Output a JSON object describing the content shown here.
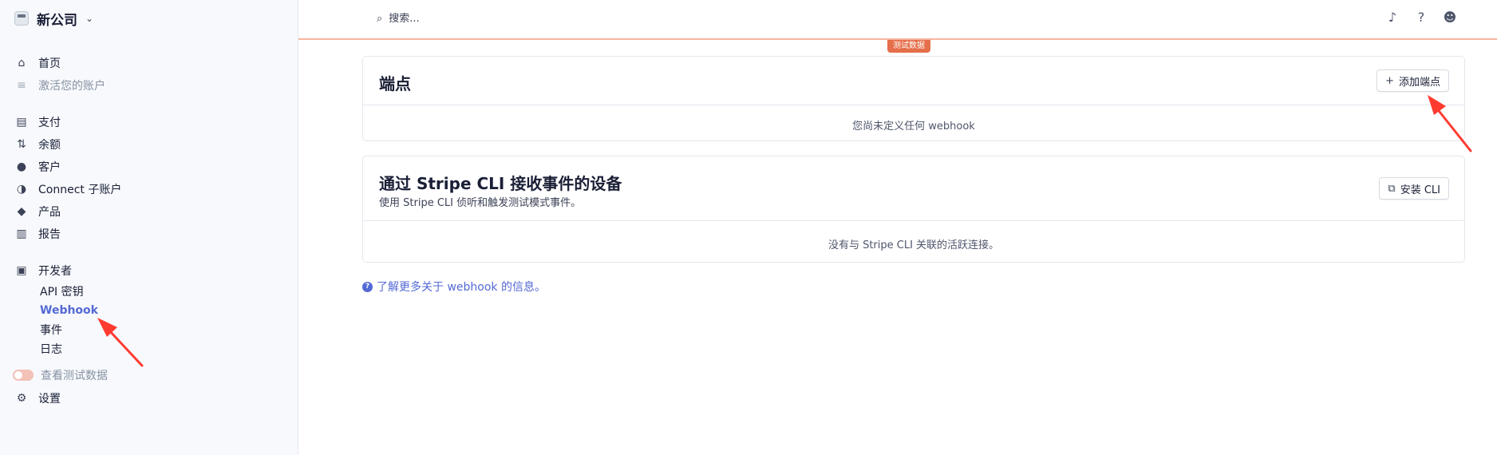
{
  "sidebar": {
    "company_name": "新公司",
    "nav_group_1": [
      {
        "label": "首页",
        "icon": "home-icon"
      },
      {
        "label": "激活您的账户",
        "icon": "activate-icon"
      }
    ],
    "nav_group_2": [
      {
        "label": "支付",
        "icon": "payments-icon"
      },
      {
        "label": "余额",
        "icon": "balance-icon"
      },
      {
        "label": "客户",
        "icon": "customer-icon"
      },
      {
        "label": "Connect 子账户",
        "icon": "connect-icon"
      },
      {
        "label": "产品",
        "icon": "product-icon"
      },
      {
        "label": "报告",
        "icon": "report-icon"
      }
    ],
    "developers": {
      "label": "开发者",
      "icon": "terminal-icon",
      "sub_items": [
        "API 密钥",
        "Webhook",
        "事件",
        "日志"
      ],
      "active_sub": "Webhook"
    },
    "test_data_toggle": "查看测试数据",
    "settings": "设置"
  },
  "header": {
    "search_placeholder": "搜索..."
  },
  "test_badge": "测试数据",
  "endpoints_card": {
    "title": "端点",
    "button": "添加端点",
    "empty": "您尚未定义任何 webhook"
  },
  "cli_card": {
    "title": "通过 Stripe CLI 接收事件的设备",
    "subtitle": "使用 Stripe CLI 侦听和触发测试模式事件。",
    "button": "安装 CLI",
    "empty": "没有与 Stripe CLI 关联的活跃连接。"
  },
  "learn_more": "了解更多关于 webhook 的信息。",
  "colors": {
    "accent": "#5469d4",
    "test_mode": "#e56f4a",
    "annotation_arrow": "#ff3b30"
  }
}
